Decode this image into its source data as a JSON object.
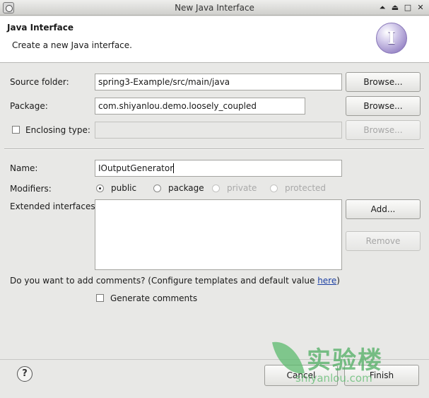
{
  "window": {
    "title": "New Java Interface"
  },
  "window_controls": [
    "⏶",
    "⏏",
    "□",
    "✕"
  ],
  "header": {
    "title": "Java Interface",
    "description": "Create a new Java interface.",
    "badge_letter": "I"
  },
  "form": {
    "source_folder": {
      "label": "Source folder:",
      "value": "spring3-Example/src/main/java",
      "browse": "Browse..."
    },
    "package": {
      "label": "Package:",
      "value": "com.shiyanlou.demo.loosely_coupled",
      "browse": "Browse..."
    },
    "enclosing_type": {
      "label": "Enclosing type:",
      "value": "",
      "browse": "Browse..."
    },
    "name": {
      "label": "Name:",
      "value": "IOutputGenerator"
    },
    "modifiers": {
      "label": "Modifiers:",
      "options": [
        "public",
        "package",
        "private",
        "protected"
      ],
      "selected": "public"
    },
    "extended_interfaces": {
      "label": "Extended interfaces:",
      "add": "Add...",
      "remove": "Remove"
    },
    "comments": {
      "question": "Do you want to add comments? (Configure templates and default value ",
      "link": "here",
      "close": ")",
      "checkbox_label": "Generate comments"
    }
  },
  "footer": {
    "help": "?",
    "cancel": "Cancel",
    "finish": "Finish"
  },
  "watermark": {
    "cn": "实验楼",
    "en": "shiyanlou.com"
  },
  "colors": {
    "header_bg": "#ffffff",
    "dialog_bg": "#e8e8e6",
    "link": "#1b3fa3"
  }
}
